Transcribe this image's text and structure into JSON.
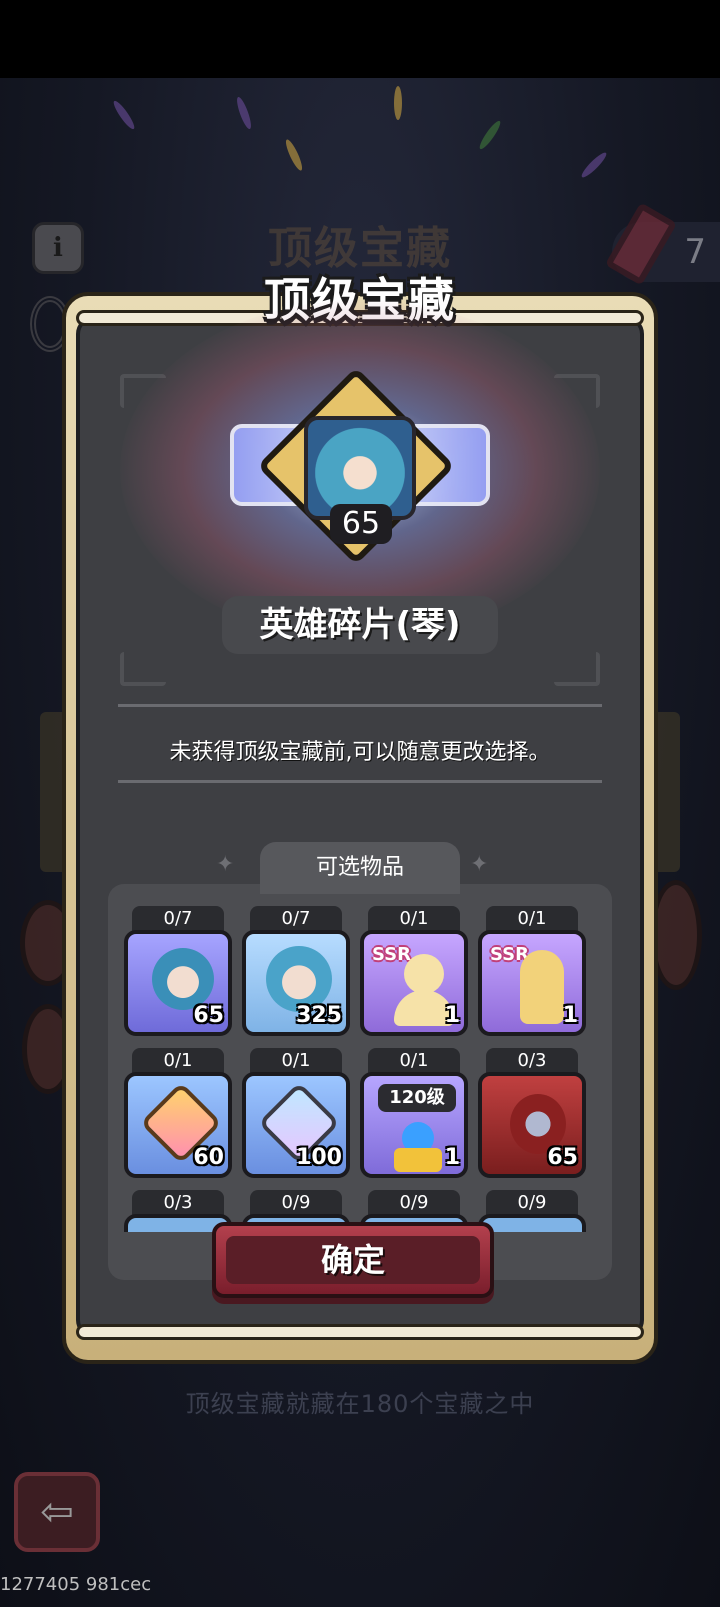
{
  "title": "顶级宝藏",
  "title_shadow": "顶级宝藏",
  "keys_count": "7",
  "featured": {
    "name": "英雄碎片(琴)",
    "count": "65"
  },
  "description": "未获得顶级宝藏前,可以随意更改选择。",
  "selectable_tab": "可选物品",
  "items": [
    {
      "progress": "0/7",
      "qty": "65"
    },
    {
      "progress": "0/7",
      "qty": "325"
    },
    {
      "progress": "0/1",
      "qty": "1",
      "tag": "SSR"
    },
    {
      "progress": "0/1",
      "qty": "1",
      "tag": "SSR"
    },
    {
      "progress": "0/1",
      "qty": "60"
    },
    {
      "progress": "0/1",
      "qty": "100"
    },
    {
      "progress": "0/1",
      "qty": "1",
      "label": "120级"
    },
    {
      "progress": "0/3",
      "qty": "65"
    },
    {
      "progress": "0/3"
    },
    {
      "progress": "0/9"
    },
    {
      "progress": "0/9"
    },
    {
      "progress": "0/9"
    }
  ],
  "confirm_button": "确定",
  "footer_text": "顶级宝藏就藏在180个宝藏之中",
  "debug_text": "1277405 981cec",
  "icons": {
    "info": "info-icon",
    "target": "target-icon",
    "key": "key-icon",
    "back": "back-arrow-icon"
  },
  "colors": {
    "panel_frame": "#e9dcb6",
    "panel_body": "#3e3f43",
    "confirm": "#9a2f3c",
    "glow": "#bcd4ff"
  }
}
